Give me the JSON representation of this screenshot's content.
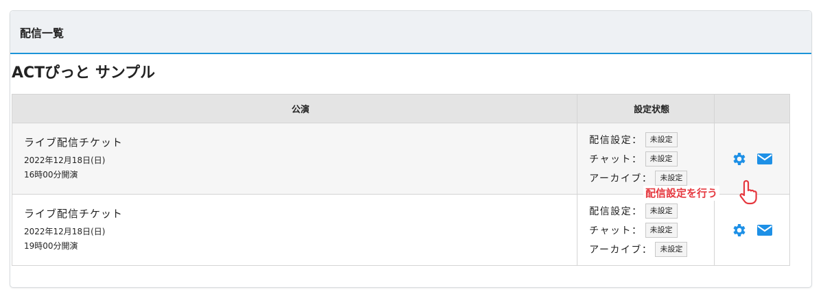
{
  "panel": {
    "title": "配信一覧"
  },
  "event": {
    "title": "ACTぴっと サンプル"
  },
  "table": {
    "headers": {
      "show": "公演",
      "status": "設定状態",
      "actions": ""
    },
    "rows": [
      {
        "ticket": "ライブ配信チケット",
        "date": "2022年12月18日(日)",
        "time": "16時00分開演",
        "status": [
          {
            "label": "配信設定：",
            "value": "未設定"
          },
          {
            "label": "チャット：",
            "value": "未設定"
          },
          {
            "label": "アーカイブ：",
            "value": "未設定"
          }
        ]
      },
      {
        "ticket": "ライブ配信チケット",
        "date": "2022年12月18日(日)",
        "time": "19時00分開演",
        "status": [
          {
            "label": "配信設定：",
            "value": "未設定"
          },
          {
            "label": "チャット：",
            "value": "未設定"
          },
          {
            "label": "アーカイブ：",
            "value": "未設定"
          }
        ]
      }
    ]
  },
  "tooltip": {
    "text": "配信設定を行う"
  },
  "icons": {
    "settings": "gear-icon",
    "mail": "envelope-icon",
    "pointer": "hand-pointer-icon"
  },
  "colors": {
    "accent": "#1b93d8",
    "icon": "#1e90e6",
    "tooltip": "#e5373e"
  }
}
